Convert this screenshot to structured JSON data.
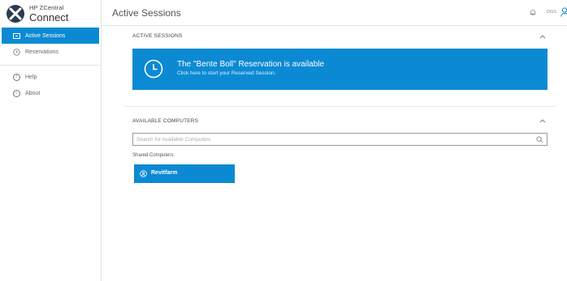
{
  "app": {
    "logo_small": "HP ZCentral",
    "logo_big": "Connect"
  },
  "sidebar": {
    "items": [
      {
        "label": "Active Sessions",
        "icon": "session-icon",
        "active": true
      },
      {
        "label": "Reservations",
        "icon": "clock-icon",
        "active": false
      },
      {
        "label": "Help",
        "icon": "help-icon",
        "active": false
      },
      {
        "label": "About",
        "icon": "info-icon",
        "active": false
      }
    ]
  },
  "header": {
    "title": "Active Sessions",
    "small_text": "DGS",
    "icons": [
      "bell-icon",
      "user-icon"
    ]
  },
  "active_sessions": {
    "heading": "ACTIVE SESSIONS",
    "banner": {
      "title": "The \"Bente Boll\" Reservation is available",
      "subtitle": "Click here to start your Reserved Session."
    }
  },
  "available_computers": {
    "heading": "AVAILABLE COMPUTERS",
    "search": {
      "value": "",
      "placeholder": "Search for Available Computers"
    },
    "shared_label": "Shared Computers:",
    "computers": [
      {
        "label": "Revitfarm",
        "icon": "computer-icon"
      }
    ]
  },
  "colors": {
    "accent": "#0b8ad3",
    "logo": "#2b3a52"
  }
}
